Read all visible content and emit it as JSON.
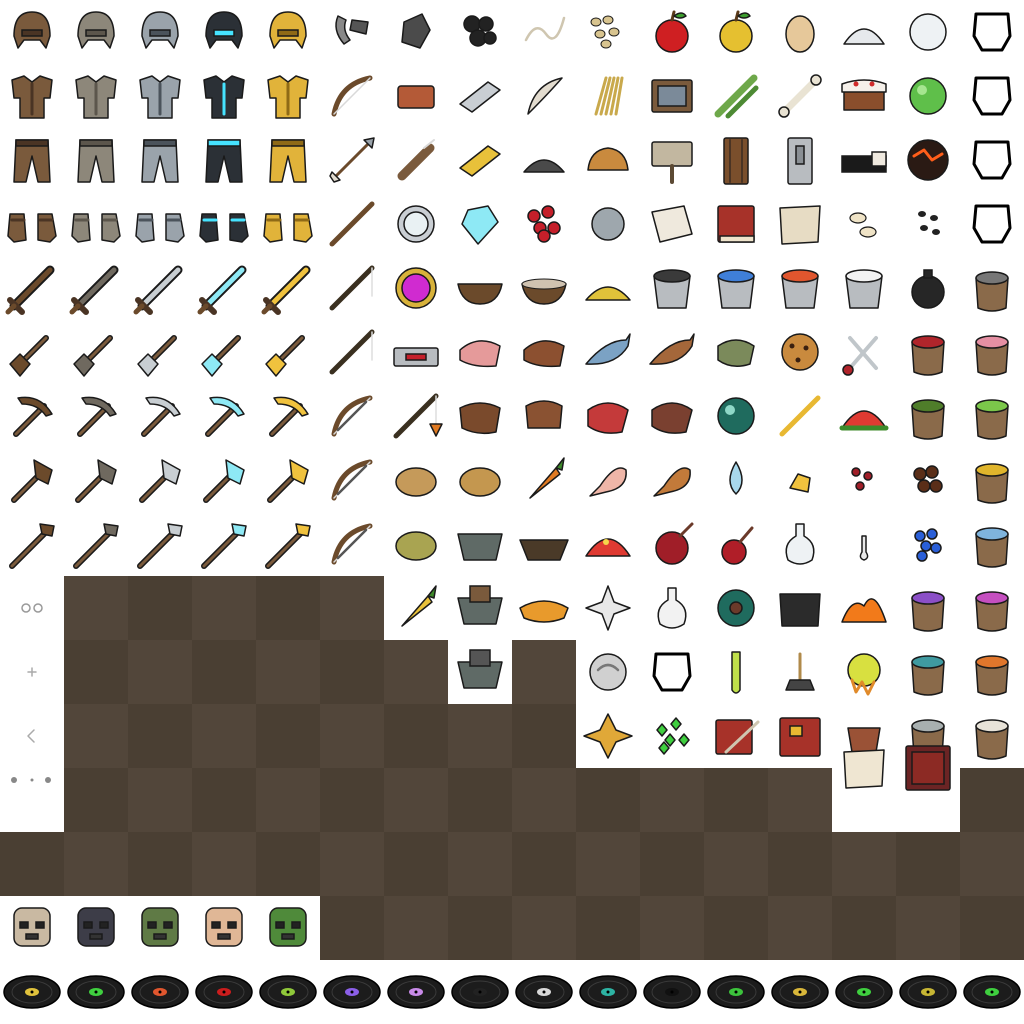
{
  "atlas": {
    "palette": {
      "leather": "#7a5a3c",
      "leather_dark": "#4a3424",
      "chain": "#8d877a",
      "iron": "#9aa3ab",
      "iron_dark": "#4b535b",
      "diamond": "#2b3036",
      "diamond_glow": "#46e3ff",
      "gold": "#e1b33a",
      "gold_dark": "#8f6a16",
      "wood": "#6b4a2b",
      "stone": "#8a8479",
      "red": "#c9242a",
      "green": "#3e9f3a",
      "bg_dark": "#4a3f33",
      "bg_dark_alt": "#52463a"
    },
    "rows": [
      {
        "row": 0,
        "icons": [
          "leather-cap",
          "chain-helmet",
          "iron-helmet",
          "diamond-helmet",
          "gold-helmet",
          "flint-and-steel",
          "flint",
          "coal",
          "string",
          "seeds",
          "apple",
          "golden-apple",
          "egg",
          "sugar",
          "snowball",
          "empty-helmet-slot"
        ]
      },
      {
        "row": 1,
        "icons": [
          "leather-tunic",
          "chain-chestplate",
          "iron-chestplate",
          "diamond-chestplate",
          "gold-chestplate",
          "bow",
          "brick",
          "iron-ingot",
          "feather",
          "wheat",
          "painting",
          "sugar-cane",
          "bone",
          "cake",
          "slimeball",
          "empty-chestplate-slot"
        ]
      },
      {
        "row": 2,
        "icons": [
          "leather-pants",
          "chain-leggings",
          "iron-leggings",
          "diamond-leggings",
          "gold-leggings",
          "arrow",
          "quiver",
          "gold-ingot",
          "gunpowder",
          "bread",
          "sign",
          "wood-door",
          "iron-door",
          "bed",
          "magma-cream",
          "empty-leggings-slot"
        ]
      },
      {
        "row": 3,
        "icons": [
          "leather-boots",
          "chain-boots",
          "iron-boots",
          "diamond-boots",
          "gold-boots",
          "stick",
          "compass",
          "diamond",
          "redstone",
          "clay-ball",
          "paper",
          "book",
          "map",
          "pumpkin-seeds",
          "melon-seeds",
          "empty-boots-slot"
        ]
      },
      {
        "row": 4,
        "icons": [
          "wood-sword",
          "stone-sword",
          "iron-sword",
          "diamond-sword",
          "gold-sword",
          "fishing-rod",
          "clock",
          "bowl",
          "mushroom-stew",
          "glowstone-dust",
          "bucket",
          "water-bucket",
          "lava-bucket",
          "milk-bucket",
          "ink-sac",
          "dye-gray"
        ]
      },
      {
        "row": 5,
        "icons": [
          "wood-shovel",
          "stone-shovel",
          "iron-shovel",
          "diamond-shovel",
          "gold-shovel",
          "fishing-rod-cast",
          "repeater",
          "raw-pork",
          "cooked-pork",
          "raw-fish",
          "cooked-fish",
          "rotten-flesh",
          "cookie",
          "shears",
          "dye-red",
          "dye-pink"
        ]
      },
      {
        "row": 6,
        "icons": [
          "wood-pickaxe",
          "stone-pickaxe",
          "iron-pickaxe",
          "diamond-pickaxe",
          "gold-pickaxe",
          "bow-pulling-0",
          "carrot-on-stick",
          "leather",
          "saddle",
          "raw-beef",
          "steak",
          "ender-pearl",
          "blaze-rod",
          "melon-slice",
          "dye-green",
          "dye-lime"
        ]
      },
      {
        "row": 7,
        "icons": [
          "wood-axe",
          "stone-axe",
          "iron-axe",
          "diamond-axe",
          "gold-axe",
          "bow-pulling-1",
          "baked-potato",
          "potato",
          "carrot",
          "raw-chicken",
          "cooked-chicken",
          "ghast-tear",
          "gold-nugget",
          "nether-wart",
          "cocoa-beans",
          "dye-yellow"
        ]
      },
      {
        "row": 8,
        "icons": [
          "wood-hoe",
          "stone-hoe",
          "iron-hoe",
          "diamond-hoe",
          "gold-hoe",
          "bow-pulling-2",
          "poisonous-potato",
          "minecart",
          "boat",
          "glistering-melon",
          "fermented-spider-eye",
          "spider-eye",
          "potion",
          "potion-overlay",
          "lapis-lazuli",
          "dye-light-blue"
        ]
      },
      {
        "row": 9,
        "icons": [
          "glasses-overlay",
          "",
          "",
          "",
          "",
          "",
          "golden-carrot",
          "storage-minecart",
          "pumpkin-pie",
          "nether-star",
          "glass-bottle",
          "eye-of-ender",
          "cauldron",
          "blaze-powder",
          "dye-purple",
          "dye-magenta"
        ]
      },
      {
        "row": 10,
        "icons": [
          "crosshair-overlay",
          "",
          "",
          "",
          "",
          "",
          "",
          "powered-minecart",
          "",
          "fire-charge",
          "empty-slot",
          "bottle-o-enchanting",
          "brewing-stand",
          "magma-drop",
          "dye-cyan",
          "dye-orange"
        ]
      },
      {
        "row": 11,
        "icons": [
          "arrow-overlay",
          "",
          "",
          "",
          "",
          "",
          "",
          "",
          "",
          "nether-quartz",
          "emerald",
          "book-and-quill",
          "written-book",
          "flower-pot",
          "dye-light-gray",
          "dye-white"
        ]
      },
      {
        "row": 12,
        "icons": [
          "dots-overlay",
          "",
          "",
          "",
          "",
          "",
          "",
          "",
          "",
          "",
          "",
          "",
          "",
          "empty-map",
          "item-frame",
          ""
        ]
      },
      {
        "row": 14,
        "icons": [
          "skull-skeleton",
          "skull-wither",
          "skull-zombie",
          "skull-steve",
          "skull-creeper"
        ]
      },
      {
        "row": 15,
        "icons": [
          "record-13",
          "record-cat",
          "record-blocks",
          "record-chirp",
          "record-far",
          "record-mall",
          "record-mellohi",
          "record-stal",
          "record-strad",
          "record-ward",
          "record-11",
          "record-wait",
          "record-13-alt",
          "record-green",
          "record-gold",
          "record-green-alt"
        ]
      }
    ],
    "record_labels": [
      "#e0c23c",
      "#3fcf3f",
      "#e0562e",
      "#cc1d1d",
      "#8fc83a",
      "#8b5fe8",
      "#c88ae8",
      "#222222",
      "#d8d8d8",
      "#2db3a3",
      "#111111",
      "#3cc33c",
      "#d9b73a",
      "#3fcf3f",
      "#c7b634",
      "#3fcf3f"
    ]
  }
}
